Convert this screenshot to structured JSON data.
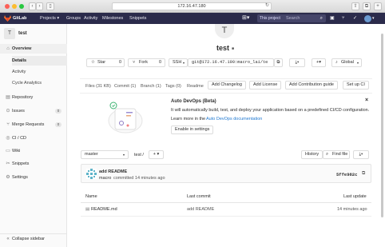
{
  "browser": {
    "url": "172.16.47.180"
  },
  "header": {
    "brand": "GitLab",
    "nav": [
      "Projects ▾",
      "Groups",
      "Activity",
      "Milestones",
      "Snippets"
    ],
    "scope_label": "This project",
    "search_placeholder": "Search"
  },
  "sidebar": {
    "avatar_letter": "T",
    "project_name": "test",
    "items": [
      {
        "label": "Overview",
        "icon": "home-icon"
      },
      {
        "label": "Details"
      },
      {
        "label": "Activity"
      },
      {
        "label": "Cycle Analytics"
      },
      {
        "label": "Repository",
        "icon": "book-icon"
      },
      {
        "label": "Issues",
        "icon": "issues-icon",
        "count": "0"
      },
      {
        "label": "Merge Requests",
        "icon": "merge-request-icon",
        "count": "0"
      },
      {
        "label": "CI / CD",
        "icon": "rocket-icon"
      },
      {
        "label": "Wiki",
        "icon": "wiki-icon"
      },
      {
        "label": "Snippets",
        "icon": "snippet-icon"
      },
      {
        "label": "Settings",
        "icon": "gear-icon"
      }
    ],
    "collapse_label": "Collapse sidebar"
  },
  "project": {
    "avatar_letter": "T",
    "name": "test",
    "star_label": "Star",
    "star_count": "0",
    "fork_label": "Fork",
    "fork_count": "0",
    "clone_protocol": "SSH",
    "clone_url": "git@172.16.47.190:macro_lai/te",
    "visibility": "Global"
  },
  "tabs": [
    "Files (31 KB)",
    "Commit (1)",
    "Branch (1)",
    "Tags (0)",
    "Readme"
  ],
  "quick_actions": [
    "Add Changelog",
    "Add License",
    "Add Contribution guide",
    "Set up CI"
  ],
  "devops": {
    "title": "Auto DevOps (Beta)",
    "body": "It will automatically build, test, and deploy your application based on a predefined CI/CD configuration.",
    "learn_prefix": "Learn more in the",
    "learn_link": "Auto DevOps documentation",
    "enable_label": "Enable in settings"
  },
  "repo": {
    "branch": "master",
    "path": "test /",
    "history_label": "History",
    "find_file_label": "Find file"
  },
  "commit": {
    "title": "add README",
    "author": "macro",
    "meta": "committed 14 minutes ago",
    "sha": "5ffe982c"
  },
  "file_table": {
    "headers": [
      "Name",
      "Last commit",
      "Last update"
    ],
    "rows": [
      {
        "name": "README.md",
        "last_commit": "add README",
        "last_update": "14 minutes ago"
      }
    ]
  }
}
